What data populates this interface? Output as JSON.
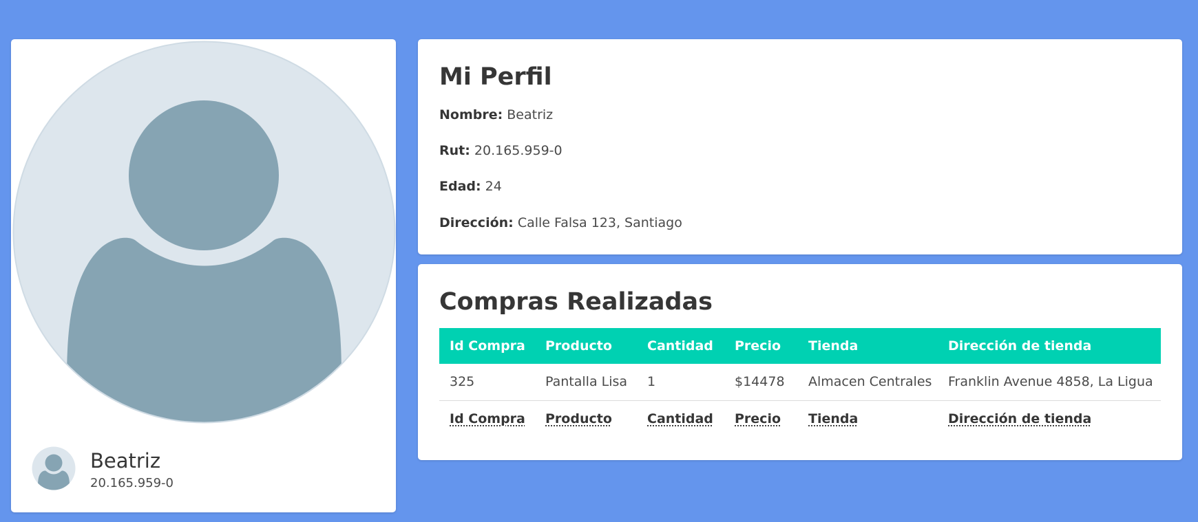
{
  "user": {
    "name": "Beatriz",
    "rut": "20.165.959-0"
  },
  "profile": {
    "title": "Mi Perfil",
    "fields": [
      {
        "label": "Nombre:",
        "value": "Beatriz"
      },
      {
        "label": "Rut:",
        "value": "20.165.959-0"
      },
      {
        "label": "Edad:",
        "value": "24"
      },
      {
        "label": "Dirección:",
        "value": "Calle Falsa 123, Santiago"
      }
    ]
  },
  "purchases": {
    "title": "Compras Realizadas",
    "columns": [
      "Id Compra",
      "Producto",
      "Cantidad",
      "Precio",
      "Tienda",
      "Dirección de tienda"
    ],
    "rows": [
      [
        "325",
        "Pantalla Lisa",
        "1",
        "$14478",
        "Almacen Centrales",
        "Franklin Avenue 4858, La Ligua"
      ]
    ]
  },
  "icons": {
    "avatar": "user-placeholder-icon"
  },
  "colors": {
    "background": "#6495ed",
    "table_header": "#00d1b2",
    "avatar_bg": "#dde6ed",
    "avatar_fg": "#86a4b3"
  }
}
